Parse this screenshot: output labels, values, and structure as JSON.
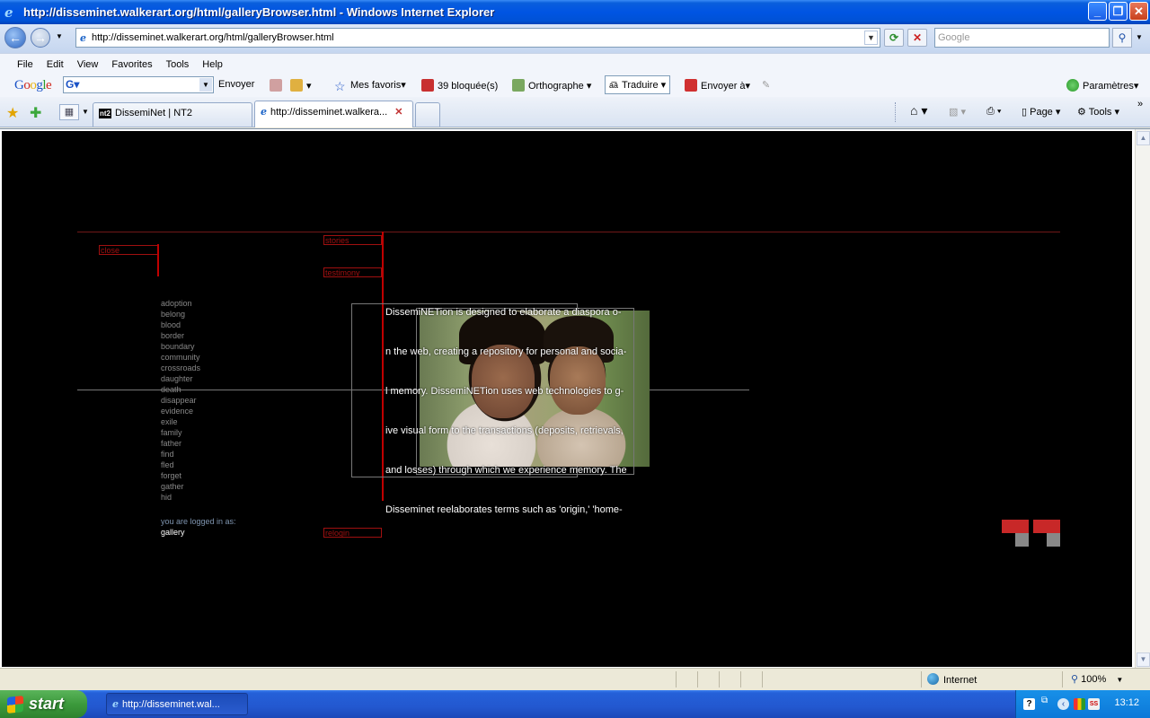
{
  "window": {
    "title": "http://disseminet.walkerart.org/html/galleryBrowser.html - Windows Internet Explorer"
  },
  "address_bar": {
    "url": "http://disseminet.walkerart.org/html/galleryBrowser.html",
    "search_placeholder": "Google"
  },
  "menu": {
    "items": [
      "File",
      "Edit",
      "View",
      "Favorites",
      "Tools",
      "Help"
    ]
  },
  "google_toolbar": {
    "logo": "Google",
    "send": "Envoyer",
    "favorites": "Mes favoris",
    "blocked": "39 bloquée(s)",
    "spelling": "Orthographe",
    "translate": "Traduire",
    "send_to": "Envoyer à",
    "settings": "Paramètres"
  },
  "tabs": [
    {
      "label": "DissemiNet | NT2",
      "favicon": "nt2"
    },
    {
      "label": "http://disseminet.walkera...",
      "active": true
    }
  ],
  "command_bar": {
    "page": "Page",
    "tools": "Tools"
  },
  "page": {
    "close_label": "close",
    "stories_label": "stories",
    "testimony_label": "testimony",
    "relogin_label": "relogin",
    "words": [
      "adoption",
      "belong",
      "blood",
      "border",
      "boundary",
      "community",
      "crossroads",
      "daughter",
      "death",
      "disappear",
      "evidence",
      "exile",
      "family",
      "father",
      "find",
      "fled",
      "forget",
      "gather",
      "hid"
    ],
    "logged_in_label": "you are logged in as:",
    "logged_in_user": "gallery",
    "text_lines": [
      "DissemiNETion is designed to elaborate a diaspora o-",
      "n the web, creating a repository for personal and socia-",
      "l memory. DissemiNETion uses web technologies to g-",
      "ive visual form to the transactions (deposits, retrievals,",
      "and losses) through which we experience memory. The",
      "Disseminet reelaborates terms such as 'origin,' 'home-"
    ],
    "accent_color": "#c00000"
  },
  "status_bar": {
    "zone": "Internet",
    "zoom": "100%"
  },
  "taskbar": {
    "start": "start",
    "item": "http://disseminet.wal...",
    "clock": "13:12"
  }
}
